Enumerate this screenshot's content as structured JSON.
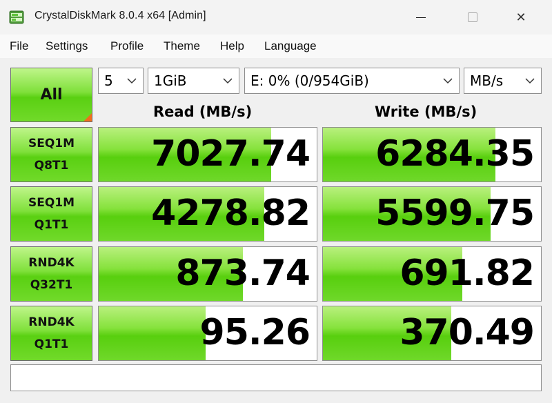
{
  "window": {
    "title": "CrystalDiskMark 8.0.4 x64 [Admin]",
    "close_glyph": "✕"
  },
  "menu": [
    "File",
    "Settings",
    "Profile",
    "Theme",
    "Help",
    "Language"
  ],
  "controls": {
    "all_label": "All",
    "count": "5",
    "size": "1GiB",
    "drive": "E: 0% (0/954GiB)",
    "unit": "MB/s"
  },
  "headers": {
    "read": "Read (MB/s)",
    "write": "Write (MB/s)"
  },
  "tests": [
    {
      "line1": "SEQ1M",
      "line2": "Q8T1",
      "read": "7027.74",
      "write": "6284.35",
      "read_fill": 0.79,
      "write_fill": 0.79
    },
    {
      "line1": "SEQ1M",
      "line2": "Q1T1",
      "read": "4278.82",
      "write": "5599.75",
      "read_fill": 0.76,
      "write_fill": 0.77
    },
    {
      "line1": "RND4K",
      "line2": "Q32T1",
      "read": "873.74",
      "write": "691.82",
      "read_fill": 0.66,
      "write_fill": 0.64
    },
    {
      "line1": "RND4K",
      "line2": "Q1T1",
      "read": "95.26",
      "write": "370.49",
      "read_fill": 0.49,
      "write_fill": 0.59
    }
  ],
  "status_text": "",
  "colors": {
    "accent_green": "#5ad012",
    "corner_orange": "#f06e1e"
  }
}
